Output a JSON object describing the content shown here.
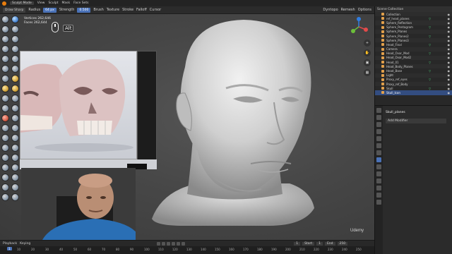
{
  "topbar": {
    "mode": "Sculpt Mode",
    "menus": [
      "View",
      "Sculpt",
      "Mask",
      "Face Sets"
    ]
  },
  "tool_header": {
    "brush_name": "Draw Sharp",
    "radius_label": "Radius",
    "radius_value": "64 px",
    "strength_label": "Strength",
    "strength_value": "0.500",
    "menus": [
      "Brush",
      "Texture",
      "Stroke",
      "Falloff",
      "Cursor"
    ],
    "right": [
      "Dyntopo",
      "Remesh",
      "Options"
    ]
  },
  "overlay": {
    "vertices_label": "Vertices",
    "vertices_value": "262,646",
    "faces_label": "Faces",
    "faces_value": "262,644",
    "key_hint": "Alt"
  },
  "timeline": {
    "menus": [
      "Playback",
      "Keying"
    ],
    "start_label": "Start",
    "start_value": "1",
    "end_label": "End",
    "end_value": "250",
    "current_frame": "1",
    "ticks": [
      "0",
      "10",
      "20",
      "30",
      "40",
      "50",
      "60",
      "70",
      "80",
      "90",
      "100",
      "110",
      "120",
      "130",
      "140",
      "150",
      "160",
      "170",
      "180",
      "190",
      "200",
      "210",
      "220",
      "230",
      "240",
      "250"
    ]
  },
  "outliner": {
    "title": "Scene Collection",
    "rows": [
      "Collection",
      "ref_head_planes",
      "Sphere_Reflection",
      "Sphere_Pentagram",
      "Sphere_Planes",
      "Sphere_Planes2",
      "Sphere_Planes3",
      "Head_Final",
      "Camera",
      "Head_Ovar_Mod",
      "Head_Ovar_Mod2",
      "Head_01",
      "Head_Body_Planes",
      "Head_Base",
      "Light",
      "Proxy_ref_eyes",
      "Proxy_ref_Body",
      "Skull",
      "Skull_Icon"
    ],
    "selected_index": 18
  },
  "properties": {
    "object_name": "Skull_planes",
    "add_modifier": "Add Modifier"
  },
  "watermark": "Udemy"
}
